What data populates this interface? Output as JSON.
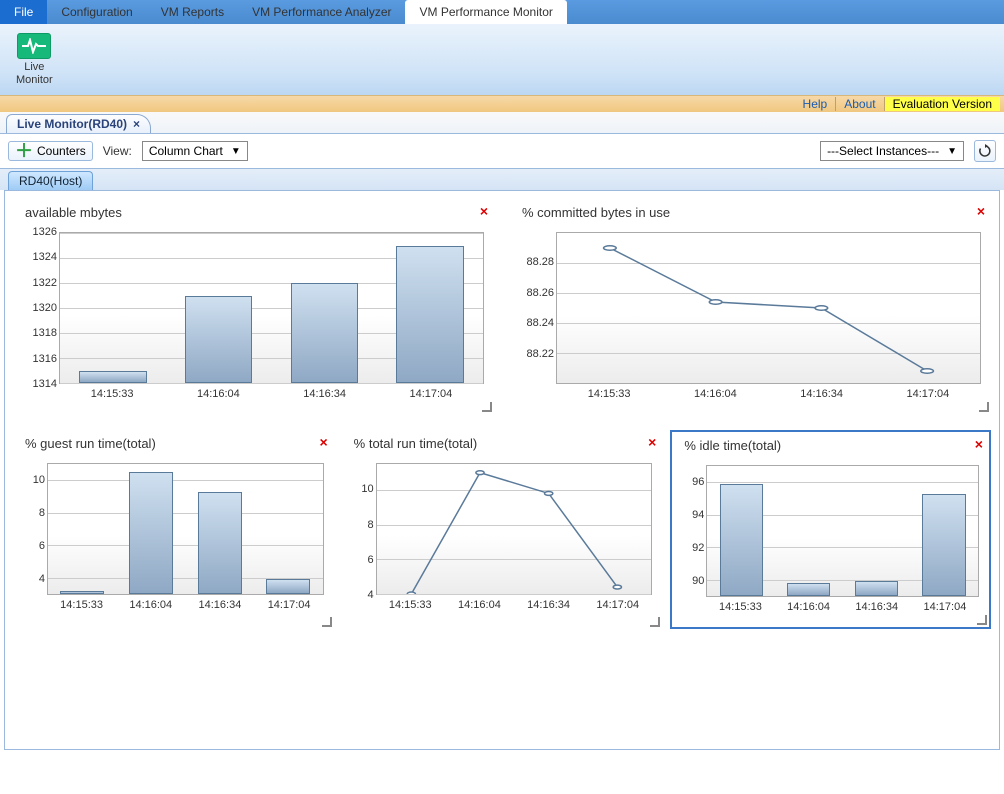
{
  "menu": {
    "file": "File",
    "configuration": "Configuration",
    "reports": "VM Reports",
    "analyzer": "VM Performance Analyzer",
    "monitor": "VM Performance Monitor"
  },
  "ribbon": {
    "live_monitor": "Live\nMonitor"
  },
  "links": {
    "help": "Help",
    "about": "About",
    "eval": "Evaluation Version"
  },
  "doc_tab": {
    "title": "Live Monitor(RD40)"
  },
  "toolbar": {
    "counters": "Counters",
    "view_label": "View:",
    "view_value": "Column Chart",
    "instances": "---Select Instances---"
  },
  "host_tab": "RD40(Host)",
  "chart_data": [
    {
      "type": "bar",
      "title": "available mbytes",
      "categories": [
        "14:15:33",
        "14:16:04",
        "14:16:34",
        "14:17:04"
      ],
      "values": [
        1315,
        1321,
        1322,
        1325
      ],
      "ylim": [
        1314,
        1326
      ],
      "yticks": [
        1314,
        1316,
        1318,
        1320,
        1322,
        1324,
        1326
      ]
    },
    {
      "type": "line",
      "title": "% committed bytes in use",
      "categories": [
        "14:15:33",
        "14:16:04",
        "14:16:34",
        "14:17:04"
      ],
      "values": [
        88.29,
        88.254,
        88.25,
        88.208
      ],
      "ylim": [
        88.2,
        88.3
      ],
      "yticks": [
        88.22,
        88.24,
        88.26,
        88.28
      ]
    },
    {
      "type": "bar",
      "title": "% guest run time(total)",
      "categories": [
        "14:15:33",
        "14:16:04",
        "14:16:34",
        "14:17:04"
      ],
      "values": [
        3.2,
        10.5,
        9.3,
        3.9
      ],
      "ylim": [
        3,
        11
      ],
      "yticks": [
        4,
        6,
        8,
        10
      ]
    },
    {
      "type": "line",
      "title": "% total run time(total)",
      "categories": [
        "14:15:33",
        "14:16:04",
        "14:16:34",
        "14:17:04"
      ],
      "values": [
        4.0,
        11.0,
        9.8,
        4.4
      ],
      "ylim": [
        4,
        11.5
      ],
      "yticks": [
        4,
        6,
        8,
        10
      ]
    },
    {
      "type": "bar",
      "title": "% idle time(total)",
      "categories": [
        "14:15:33",
        "14:16:04",
        "14:16:34",
        "14:17:04"
      ],
      "values": [
        95.9,
        89.8,
        89.9,
        95.3
      ],
      "ylim": [
        89,
        97
      ],
      "yticks": [
        90,
        92,
        94,
        96
      ],
      "selected": true
    }
  ]
}
